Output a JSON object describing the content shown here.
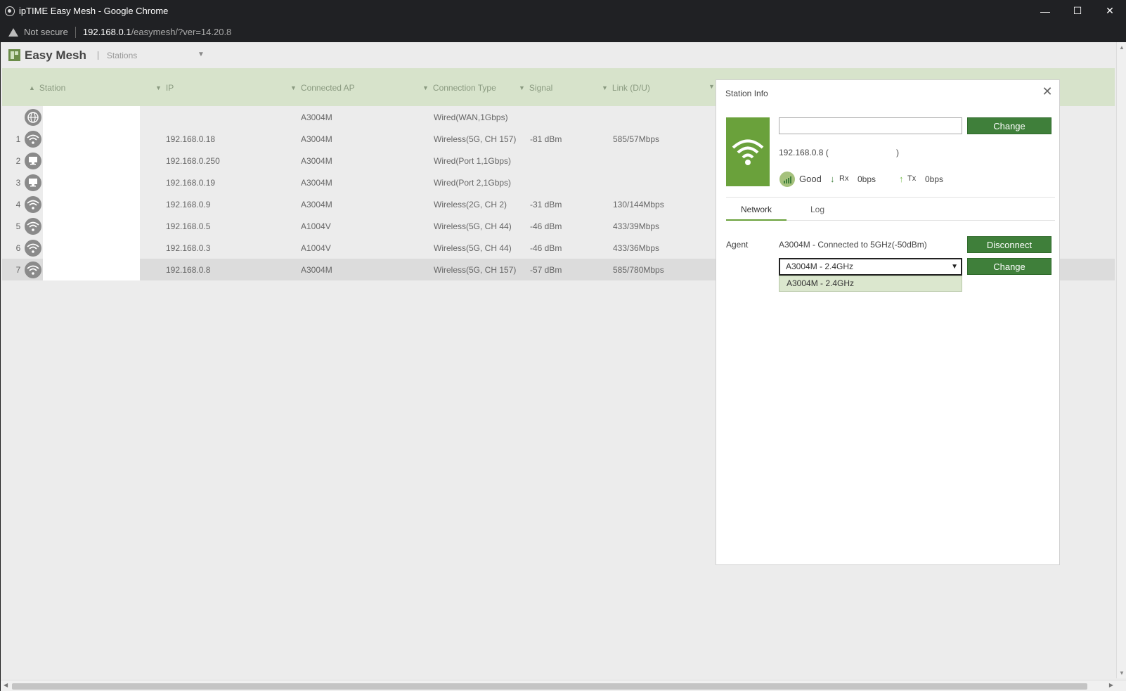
{
  "browser": {
    "window_title": "ipTIME Easy Mesh - Google Chrome",
    "security_label": "Not secure",
    "url_host": "192.168.0.1",
    "url_path": "/easymesh/?ver=14.20.8"
  },
  "app": {
    "title": "Easy Mesh",
    "view_selector": "Stations"
  },
  "table": {
    "columns": {
      "station": "Station",
      "ip": "IP",
      "connected_ap": "Connected AP",
      "connection_type": "Connection Type",
      "signal": "Signal",
      "link": "Link (D/U)"
    },
    "rows": [
      {
        "num": "",
        "icon": "globe-icon",
        "ip": "",
        "ap": "A3004M",
        "type": "Wired(WAN,1Gbps)",
        "signal": "",
        "link": ""
      },
      {
        "num": "1",
        "icon": "wifi-icon",
        "ip": "192.168.0.18",
        "ap": "A3004M",
        "type": "Wireless(5G, CH 157)",
        "signal": "-81 dBm",
        "link": "585/57Mbps"
      },
      {
        "num": "2",
        "icon": "monitor-icon",
        "ip": "192.168.0.250",
        "ap": "A3004M",
        "type": "Wired(Port 1,1Gbps)",
        "signal": "",
        "link": ""
      },
      {
        "num": "3",
        "icon": "monitor-icon",
        "ip": "192.168.0.19",
        "ap": "A3004M",
        "type": "Wired(Port 2,1Gbps)",
        "signal": "",
        "link": ""
      },
      {
        "num": "4",
        "icon": "wifi-icon",
        "ip": "192.168.0.9",
        "ap": "A3004M",
        "type": "Wireless(2G, CH 2)",
        "signal": "-31 dBm",
        "link": "130/144Mbps"
      },
      {
        "num": "5",
        "icon": "wifi-icon",
        "ip": "192.168.0.5",
        "ap": "A1004V",
        "type": "Wireless(5G, CH 44)",
        "signal": "-46 dBm",
        "link": "433/39Mbps"
      },
      {
        "num": "6",
        "icon": "wifi-icon",
        "ip": "192.168.0.3",
        "ap": "A1004V",
        "type": "Wireless(5G, CH 44)",
        "signal": "-46 dBm",
        "link": "433/36Mbps"
      },
      {
        "num": "7",
        "icon": "wifi-icon",
        "ip": "192.168.0.8",
        "ap": "A3004M",
        "type": "Wireless(5G, CH 157)",
        "signal": "-57 dBm",
        "link": "585/780Mbps"
      }
    ]
  },
  "panel": {
    "title": "Station Info",
    "name_value": "",
    "change_label": "Change",
    "ip_text": "192.168.0.8 (",
    "ip_close": ")",
    "signal_quality": "Good",
    "rx_label": "Rx",
    "rx_value": "0bps",
    "tx_label": "Tx",
    "tx_value": "0bps",
    "tabs": [
      "Network",
      "Log"
    ],
    "agent_label": "Agent",
    "agent_status": "A3004M - Connected to 5GHz(-50dBm)",
    "disconnect_label": "Disconnect",
    "agent_select_value": "A3004M - 2.4GHz",
    "agent_change_label": "Change",
    "dropdown_options": [
      "A3004M - 2.4GHz"
    ]
  },
  "colors": {
    "accent_green": "#3f7f3a",
    "tile_green": "#6aa13b",
    "header_green": "#d7e3cb"
  }
}
